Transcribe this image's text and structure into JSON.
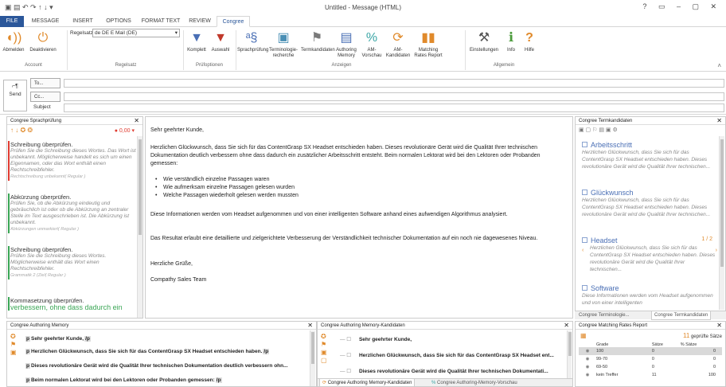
{
  "window": {
    "title": "Untitled - Message (HTML)",
    "help": "?",
    "controls": "▭ – ▢ ✕"
  },
  "tabs": [
    {
      "label": "FILE",
      "kind": "file"
    },
    {
      "label": "MESSAGE"
    },
    {
      "label": "INSERT"
    },
    {
      "label": "OPTIONS"
    },
    {
      "label": "FORMAT TEXT"
    },
    {
      "label": "REVIEW"
    },
    {
      "label": "Congree",
      "kind": "active"
    }
  ],
  "ribbon": {
    "account": {
      "abmelden": "Abmelden",
      "deaktivieren": "Deaktivieren",
      "group": "Account"
    },
    "regelsatz": {
      "label": "Regelsatz",
      "value": "de DE  E Mail (DE)",
      "group": "Regelsatz"
    },
    "pruef": {
      "komplett": "Komplett",
      "auswahl": "Auswahl",
      "group": "Prüfoptionen"
    },
    "anzeigen": {
      "items": [
        "Sprachprüfung",
        "Terminologie-\nrecherche",
        "Termkandidaten",
        "Authoring\nMemory",
        "AM-\nVorschau",
        "AM-\nKandidaten",
        "Matching\nRates Report"
      ],
      "group": "Anzeigen"
    },
    "allgemein": {
      "items": [
        "Einstellungen",
        "Info",
        "Hilfe"
      ],
      "group": "Allgemein"
    }
  },
  "mail": {
    "send": "Send",
    "to": "To...",
    "cc": "Cc...",
    "subject": "Subject"
  },
  "left": {
    "title": "Congree Sprachprüfung",
    "score": "● 0,00",
    "items": [
      {
        "title": "Schreibung überprüfen.",
        "desc": "Prüfen Sie die Schreibung dieses Wortes. Das Wort ist unbekannt. Möglicherweise handelt es sich um einen Eigennamen, oder das Wort enthält einen Rechtschreibfehler.",
        "rule": "Rechtschreibung unbekannt( Regular )",
        "color": "#e03c31"
      },
      {
        "title": "Abkürzung überprüfen.",
        "desc": "Prüfen Sie, ob die Abkürzung eindeutig und gebräuchlich ist oder ob die Abkürzung an zentraler Stelle im Text ausgeschrieben ist. Die Abkürzung ist unbekannt.",
        "rule": "Abkürzungen unmarkiert( Regular )",
        "color": "#3aa655"
      },
      {
        "title": "Schreibung überprüfen.",
        "desc": "Prüfen Sie die Schreibung dieses Wortes. Möglicherweise enthält das Wort einen Rechtschreibfehler.",
        "rule": "Grammatik 2 (Ziel( Regular )",
        "color": "#3aa655"
      },
      {
        "title": "Kommasetzung überprüfen.",
        "desc": "verbessern, ohne dass dadurch ein",
        "rule": "",
        "color": "#3aa655"
      }
    ]
  },
  "editor": {
    "greeting": "Sehr geehrter Kunde,",
    "p1": "Herzlichen Glückwunsch, dass Sie sich für das ContentGrasp SX Headset entschieden haben. Dieses revolutionäre Gerät wird die Qualität Ihrer technischen Dokumentation deutlich verbessern ohne dass dadurch ein zusätzlicher Arbeitsschritt entsteht. Beim normalen Lektorat wird bei den Lektoren oder Probanden gemessen:",
    "bullets": [
      "Wie verständlich einzelne Passagen waren",
      "Wie aufmerksam einzelne Passagen gelesen wurden",
      "Welche Passagen wiederholt gelesen werden mussten"
    ],
    "p2": "Diese Informationen werden vom Headset aufgenommen und von einer intelligenten Software anhand eines aufwendigen Algorithmus analysiert.",
    "p3": "Das Resultat erlaubt eine detaillierte und zielgerichtete Verbesserung der Verständlichkeit technischer Dokumentation auf ein noch nie dagewesenes Niveau.",
    "closing": "Herzliche Grüße,",
    "sig": "Compathy Sales Team"
  },
  "right": {
    "title": "Congree Termkandidaten",
    "terms": [
      {
        "term": "Arbeitsschritt",
        "desc": "Herzlichen Glückwunsch, dass Sie sich für das ContentGrasp SX Headset entschieden haben. Dieses revolutionäre Gerät wird die Qualität Ihrer technischen..."
      },
      {
        "term": "Glückwunsch",
        "desc": "Herzlichen Glückwunsch, dass Sie sich für das ContentGrasp SX Headset entschieden haben. Dieses revolutionäre Gerät wird die Qualität Ihrer technischen..."
      },
      {
        "term": "Headset",
        "pager": "1 / 2",
        "desc": "Herzlichen Glückwunsch, dass Sie sich für das ContentGrasp SX Headset entschieden haben. Dieses revolutionäre Gerät wird die Qualität Ihrer technischen..."
      },
      {
        "term": "Software",
        "desc": "Diese Informationen werden vom Headset aufgenommen und von einer intelligenten"
      }
    ],
    "tabs": [
      "Congree Terminologie...",
      "Congree Termkandidaten"
    ]
  },
  "memory": {
    "title": "Congree Authoring Memory",
    "rows": [
      "Sehr geehrter Kunde,",
      "Herzlichen Glückwunsch, dass Sie sich für das ContentGrasp SX Headset entschieden haben.",
      "Dieses revolutionäre Gerät wird die Qualität Ihrer technischen Dokumentation deutlich verbessern ohn...",
      "Beim normalen Lektorat wird bei den Lektoren oder Probanden gemessen:"
    ]
  },
  "mcand": {
    "title": "Congree Authoring Memory-Kandidaten",
    "rows": [
      "Sehr geehrter Kunde,",
      "Herzlichen Glückwunsch, dass Sie sich für das ContentGrasp SX Headset ent...",
      "Dieses revolutionäre Gerät wird die Qualität Ihrer technischen Dokumentati..."
    ],
    "tabs": [
      "Congree Authoring Memory-Kandidaten",
      "Congree Authoring-Memory-Vorschau"
    ]
  },
  "mrates": {
    "title": "Congree Matching Rates Report",
    "count": "11",
    "count_label": "geprüfte Sätze",
    "cols": [
      "Grade",
      "Sätze",
      "% Sätze"
    ],
    "rows": [
      [
        "100",
        "0",
        "0"
      ],
      [
        "99-70",
        "0",
        "0"
      ],
      [
        "69-50",
        "0",
        "0"
      ],
      [
        "kein Treffer",
        "11",
        "100"
      ]
    ]
  }
}
